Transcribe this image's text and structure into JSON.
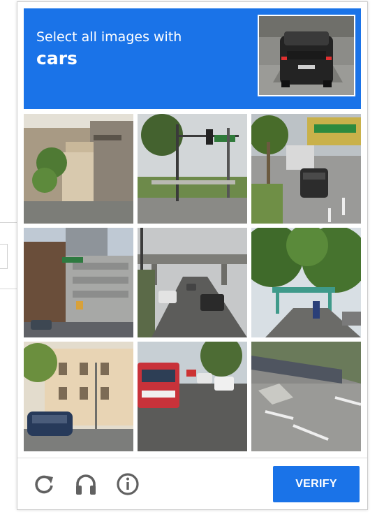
{
  "challenge": {
    "instruction": "Select all images with",
    "target": "cars"
  },
  "tiles": [
    {
      "row": 1,
      "col": 1,
      "scene": "building-entrance-staircase"
    },
    {
      "row": 1,
      "col": 2,
      "scene": "traffic-light-intersection"
    },
    {
      "row": 1,
      "col": 3,
      "scene": "street-with-car"
    },
    {
      "row": 2,
      "col": 1,
      "scene": "city-building-corner"
    },
    {
      "row": 2,
      "col": 2,
      "scene": "road-under-overpass"
    },
    {
      "row": 2,
      "col": 3,
      "scene": "park-with-trees"
    },
    {
      "row": 3,
      "col": 1,
      "scene": "street-with-parked-car"
    },
    {
      "row": 3,
      "col": 2,
      "scene": "street-with-bus"
    },
    {
      "row": 3,
      "col": 3,
      "scene": "road-markings"
    }
  ],
  "footer": {
    "reload_icon": "reload-icon",
    "audio_icon": "headphones-icon",
    "info_icon": "info-icon",
    "verify_label": "VERIFY"
  },
  "colors": {
    "accent": "#1a73e8",
    "icon": "#616161"
  }
}
